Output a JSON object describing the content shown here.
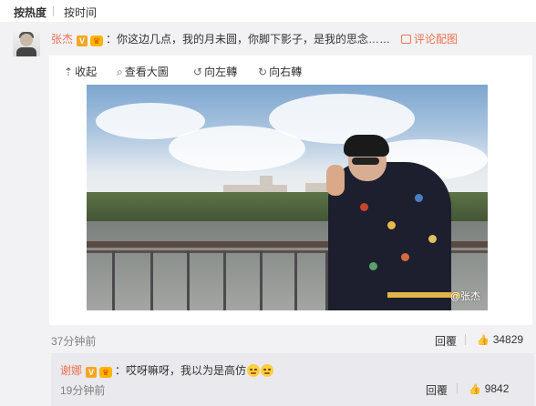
{
  "sort_tabs": [
    {
      "label": "按热度",
      "active": true
    },
    {
      "label": "按时间",
      "active": false
    }
  ],
  "comment": {
    "username": "张杰",
    "badge_v": "V",
    "crown_icon": "crown-icon",
    "text": "：你这边几点，我的月未圆，你脚下影子，是我的思念……",
    "comment_with_pic": "评论配图",
    "media_tools": {
      "collapse": "收起",
      "view_large": "查看大圖",
      "rotate_left": "向左轉",
      "rotate_right": "向右轉"
    },
    "watermark": "@张杰",
    "time": "37分钟前",
    "reply_label": "回覆",
    "likes": "34829"
  },
  "sub_reply": {
    "username": "谢娜",
    "badge_v": "V",
    "text": "：哎呀嘛呀，我以为是高仿",
    "time": "19分钟前",
    "reply_label": "回覆",
    "likes": "9842"
  },
  "colors": {
    "username": "#eb7350",
    "muted": "#808080",
    "panel_bg": "#f2f2f5",
    "subreply_bg": "#e9e9ee"
  }
}
